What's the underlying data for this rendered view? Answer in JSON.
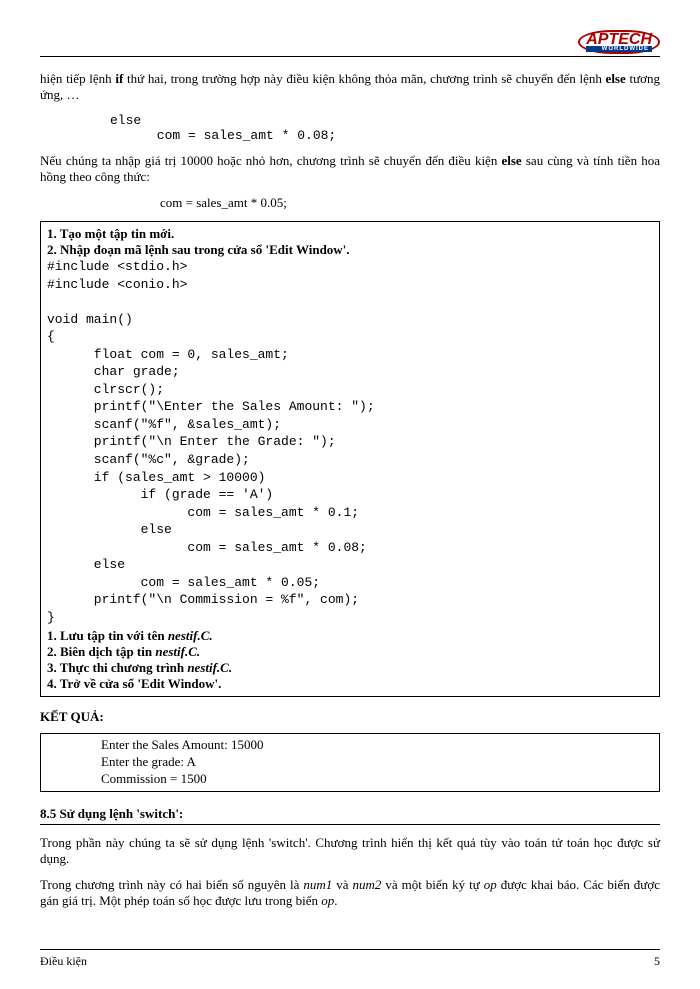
{
  "logo": {
    "text": "APTECH",
    "sub": "WORLDWIDE"
  },
  "para1_pre": "hiện tiếp lệnh ",
  "para1_if": "if",
  "para1_mid": " thứ hai, trong trường hợp này điều kiện không thỏa mãn, chương trình sẽ chuyển đến lệnh ",
  "para1_else": "else",
  "para1_post": " tương ứng, …",
  "snippet1_l1": "else",
  "snippet1_l2": "      com = sales_amt * 0.08;",
  "para2_pre": "Nếu chúng ta nhập giá trị 10000 hoặc nhỏ hơn, chương trình sẽ chuyển đến điều kiện ",
  "para2_else": "else",
  "para2_post": " sau cùng và tính tiền hoa hồng theo công thức:",
  "formula": "com = sales_amt * 0.05;",
  "listing": {
    "step1": "1.  Tạo một tập tin mới.",
    "step2": "2.  Nhập đoạn mã lệnh sau trong cửa sổ 'Edit Window'.",
    "code": "#include <stdio.h>\n#include <conio.h>\n\nvoid main()\n{\n      float com = 0, sales_amt;\n      char grade;\n      clrscr();\n      printf(\"\\Enter the Sales Amount: \");\n      scanf(\"%f\", &sales_amt);\n      printf(\"\\n Enter the Grade: \");\n      scanf(\"%c\", &grade);\n      if (sales_amt > 10000)\n            if (grade == 'A')\n                  com = sales_amt * 0.1;\n            else\n                  com = sales_amt * 0.08;\n      else\n            com = sales_amt * 0.05;\n      printf(\"\\n Commission = %f\", com);\n}",
    "foot1_pre": "1.  Lưu tập tin với tên ",
    "foot1_file": "nestif.C.",
    "foot2_pre": "2.  Biên dịch tập tin ",
    "foot2_file": "nestif.C.",
    "foot3_pre": "3.  Thực thi chương trình ",
    "foot3_file": "nestif.C.",
    "foot4": "4.  Trở về cửa sổ 'Edit Window'."
  },
  "result_head": "KẾT QUẢ:",
  "output_l1": "Enter the Sales Amount: 15000",
  "output_l2": "Enter the grade: A",
  "output_l3": "Commission = 1500",
  "subsection_title": "8.5 Sử dụng lệnh 'switch':",
  "para3": "Trong phần này chúng ta sẽ sử dụng lệnh 'switch'. Chương trình hiển thị kết quả tùy vào toán tử toán học được sử dụng.",
  "para4_pre": "Trong chương trình này có hai biến số nguyên là ",
  "para4_num1": "num1",
  "para4_and": " và ",
  "para4_num2": "num2",
  "para4_mid": " và một biến ký tự ",
  "para4_op1": "op",
  "para4_mid2": " được khai báo. Các biến được gán giá trị. Một phép toán số học được lưu trong biến ",
  "para4_op2": "op",
  "para4_end": ".",
  "footer_left": "Điều kiện",
  "footer_right": "5"
}
